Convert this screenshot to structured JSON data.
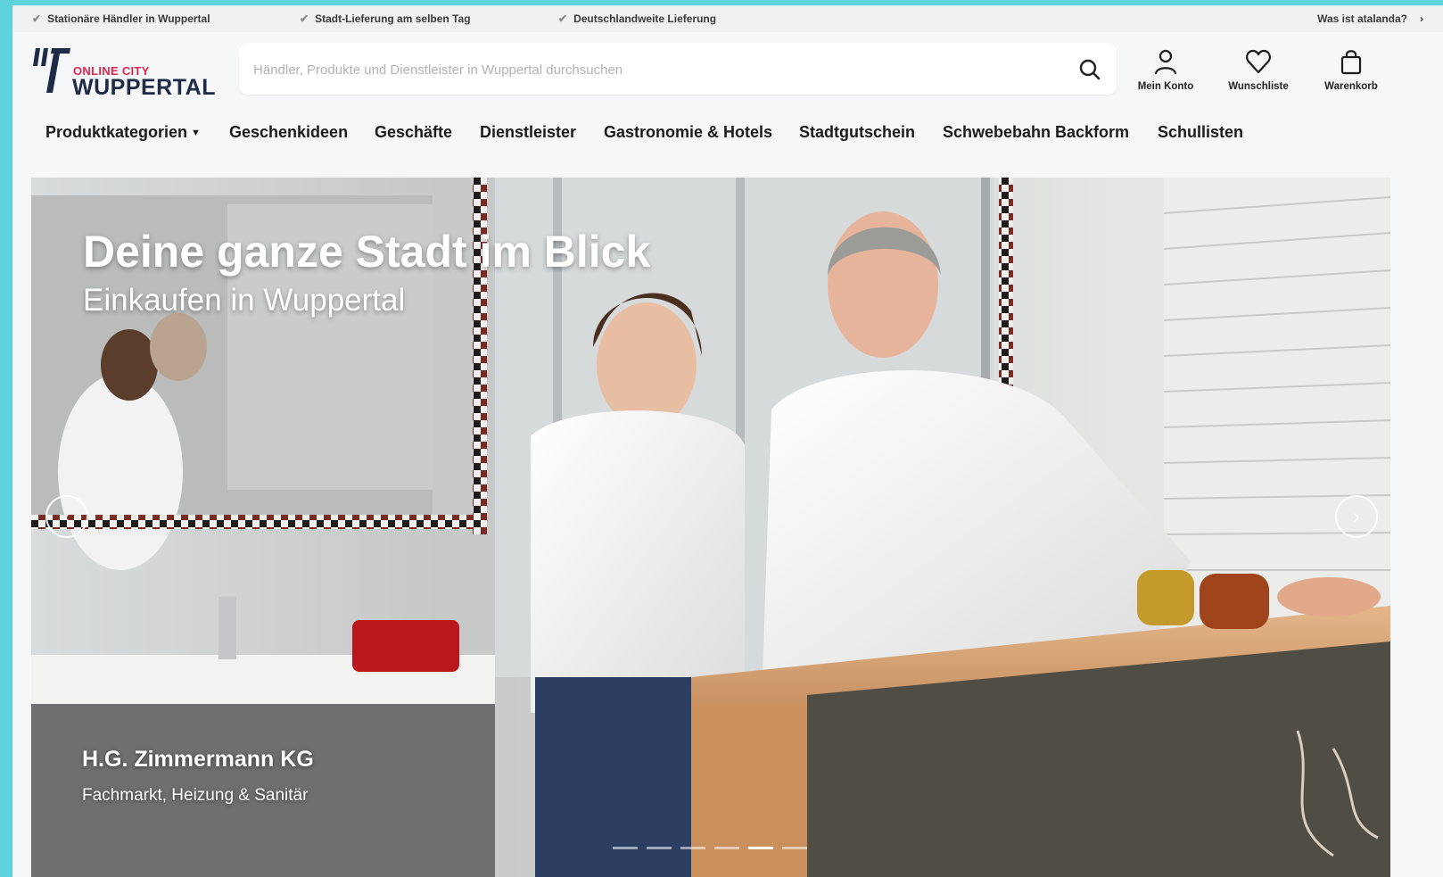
{
  "topbar": {
    "usps": [
      "Stationäre Händler in Wuppertal",
      "Stadt-Lieferung am selben Tag",
      "Deutschlandweite Lieferung"
    ],
    "about_link": "Was ist atalanda?",
    "check_icon": "check-icon"
  },
  "header": {
    "logo_small": "ONLINE CITY",
    "logo_big": "WUPPERTAL",
    "search_placeholder": "Händler, Produkte und Dienstleister in Wuppertal durchsuchen",
    "account_label": "Mein Konto",
    "wishlist_label": "Wunschliste",
    "cart_label": "Warenkorb"
  },
  "nav": {
    "items": [
      "Produktkategorien",
      "Geschenkideen",
      "Geschäfte",
      "Dienstleister",
      "Gastronomie & Hotels",
      "Stadtgutschein",
      "Schwebebahn Backform",
      "Schullisten"
    ]
  },
  "hero": {
    "title": "Deine ganze Stadt im Blick",
    "subtitle": "Einkaufen in Wuppertal",
    "shop_name": "H.G. Zimmermann KG",
    "shop_description": "Fachmarkt, Heizung & Sanitär",
    "slide_count": 6,
    "active_slide": 5
  },
  "colors": {
    "accent": "#e3254a",
    "brand_dark": "#1f2b46",
    "frame": "#5fd3dc"
  }
}
